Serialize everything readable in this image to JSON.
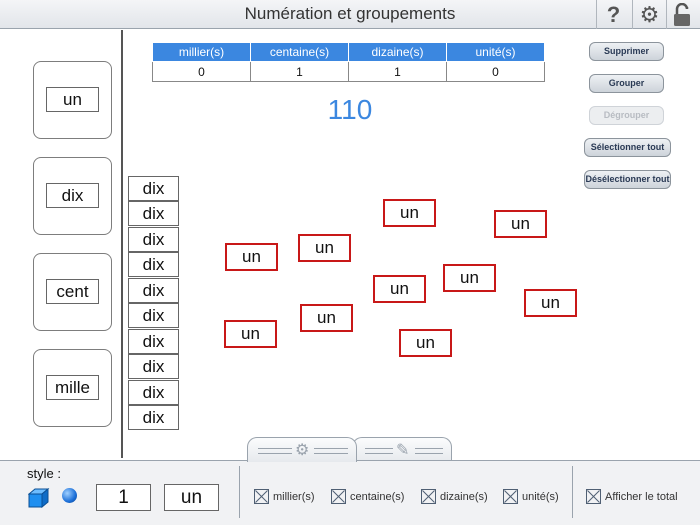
{
  "header": {
    "title": "Numération et groupements",
    "help_icon": "question-icon",
    "settings_icon": "gear-icon",
    "lock_icon": "lock-icon"
  },
  "bank": {
    "items": [
      "un",
      "dix",
      "cent",
      "mille"
    ]
  },
  "table": {
    "headers": [
      "millier(s)",
      "centaine(s)",
      "dizaine(s)",
      "unité(s)"
    ],
    "values": [
      "0",
      "1",
      "1",
      "0"
    ]
  },
  "total": "110",
  "actions": {
    "delete": "Supprimer",
    "group": "Grouper",
    "ungroup": "Dégrouper",
    "select_all": "Sélectionner tout",
    "deselect_all": "Désélectionner tout"
  },
  "workspace": {
    "dix_labels": [
      "dix",
      "dix",
      "dix",
      "dix",
      "dix",
      "dix",
      "dix",
      "dix",
      "dix",
      "dix"
    ],
    "un_labels": [
      "un",
      "un",
      "un",
      "un",
      "un",
      "un",
      "un",
      "un",
      "un",
      "un"
    ]
  },
  "bottom": {
    "style_label": "style :",
    "quantity": "1",
    "unit": "un",
    "checkboxes": [
      "millier(s)",
      "centaine(s)",
      "dizaine(s)",
      "unité(s)",
      "Afficher le total"
    ]
  },
  "colors": {
    "accent": "#3b87e0",
    "un_border": "#c81818"
  }
}
